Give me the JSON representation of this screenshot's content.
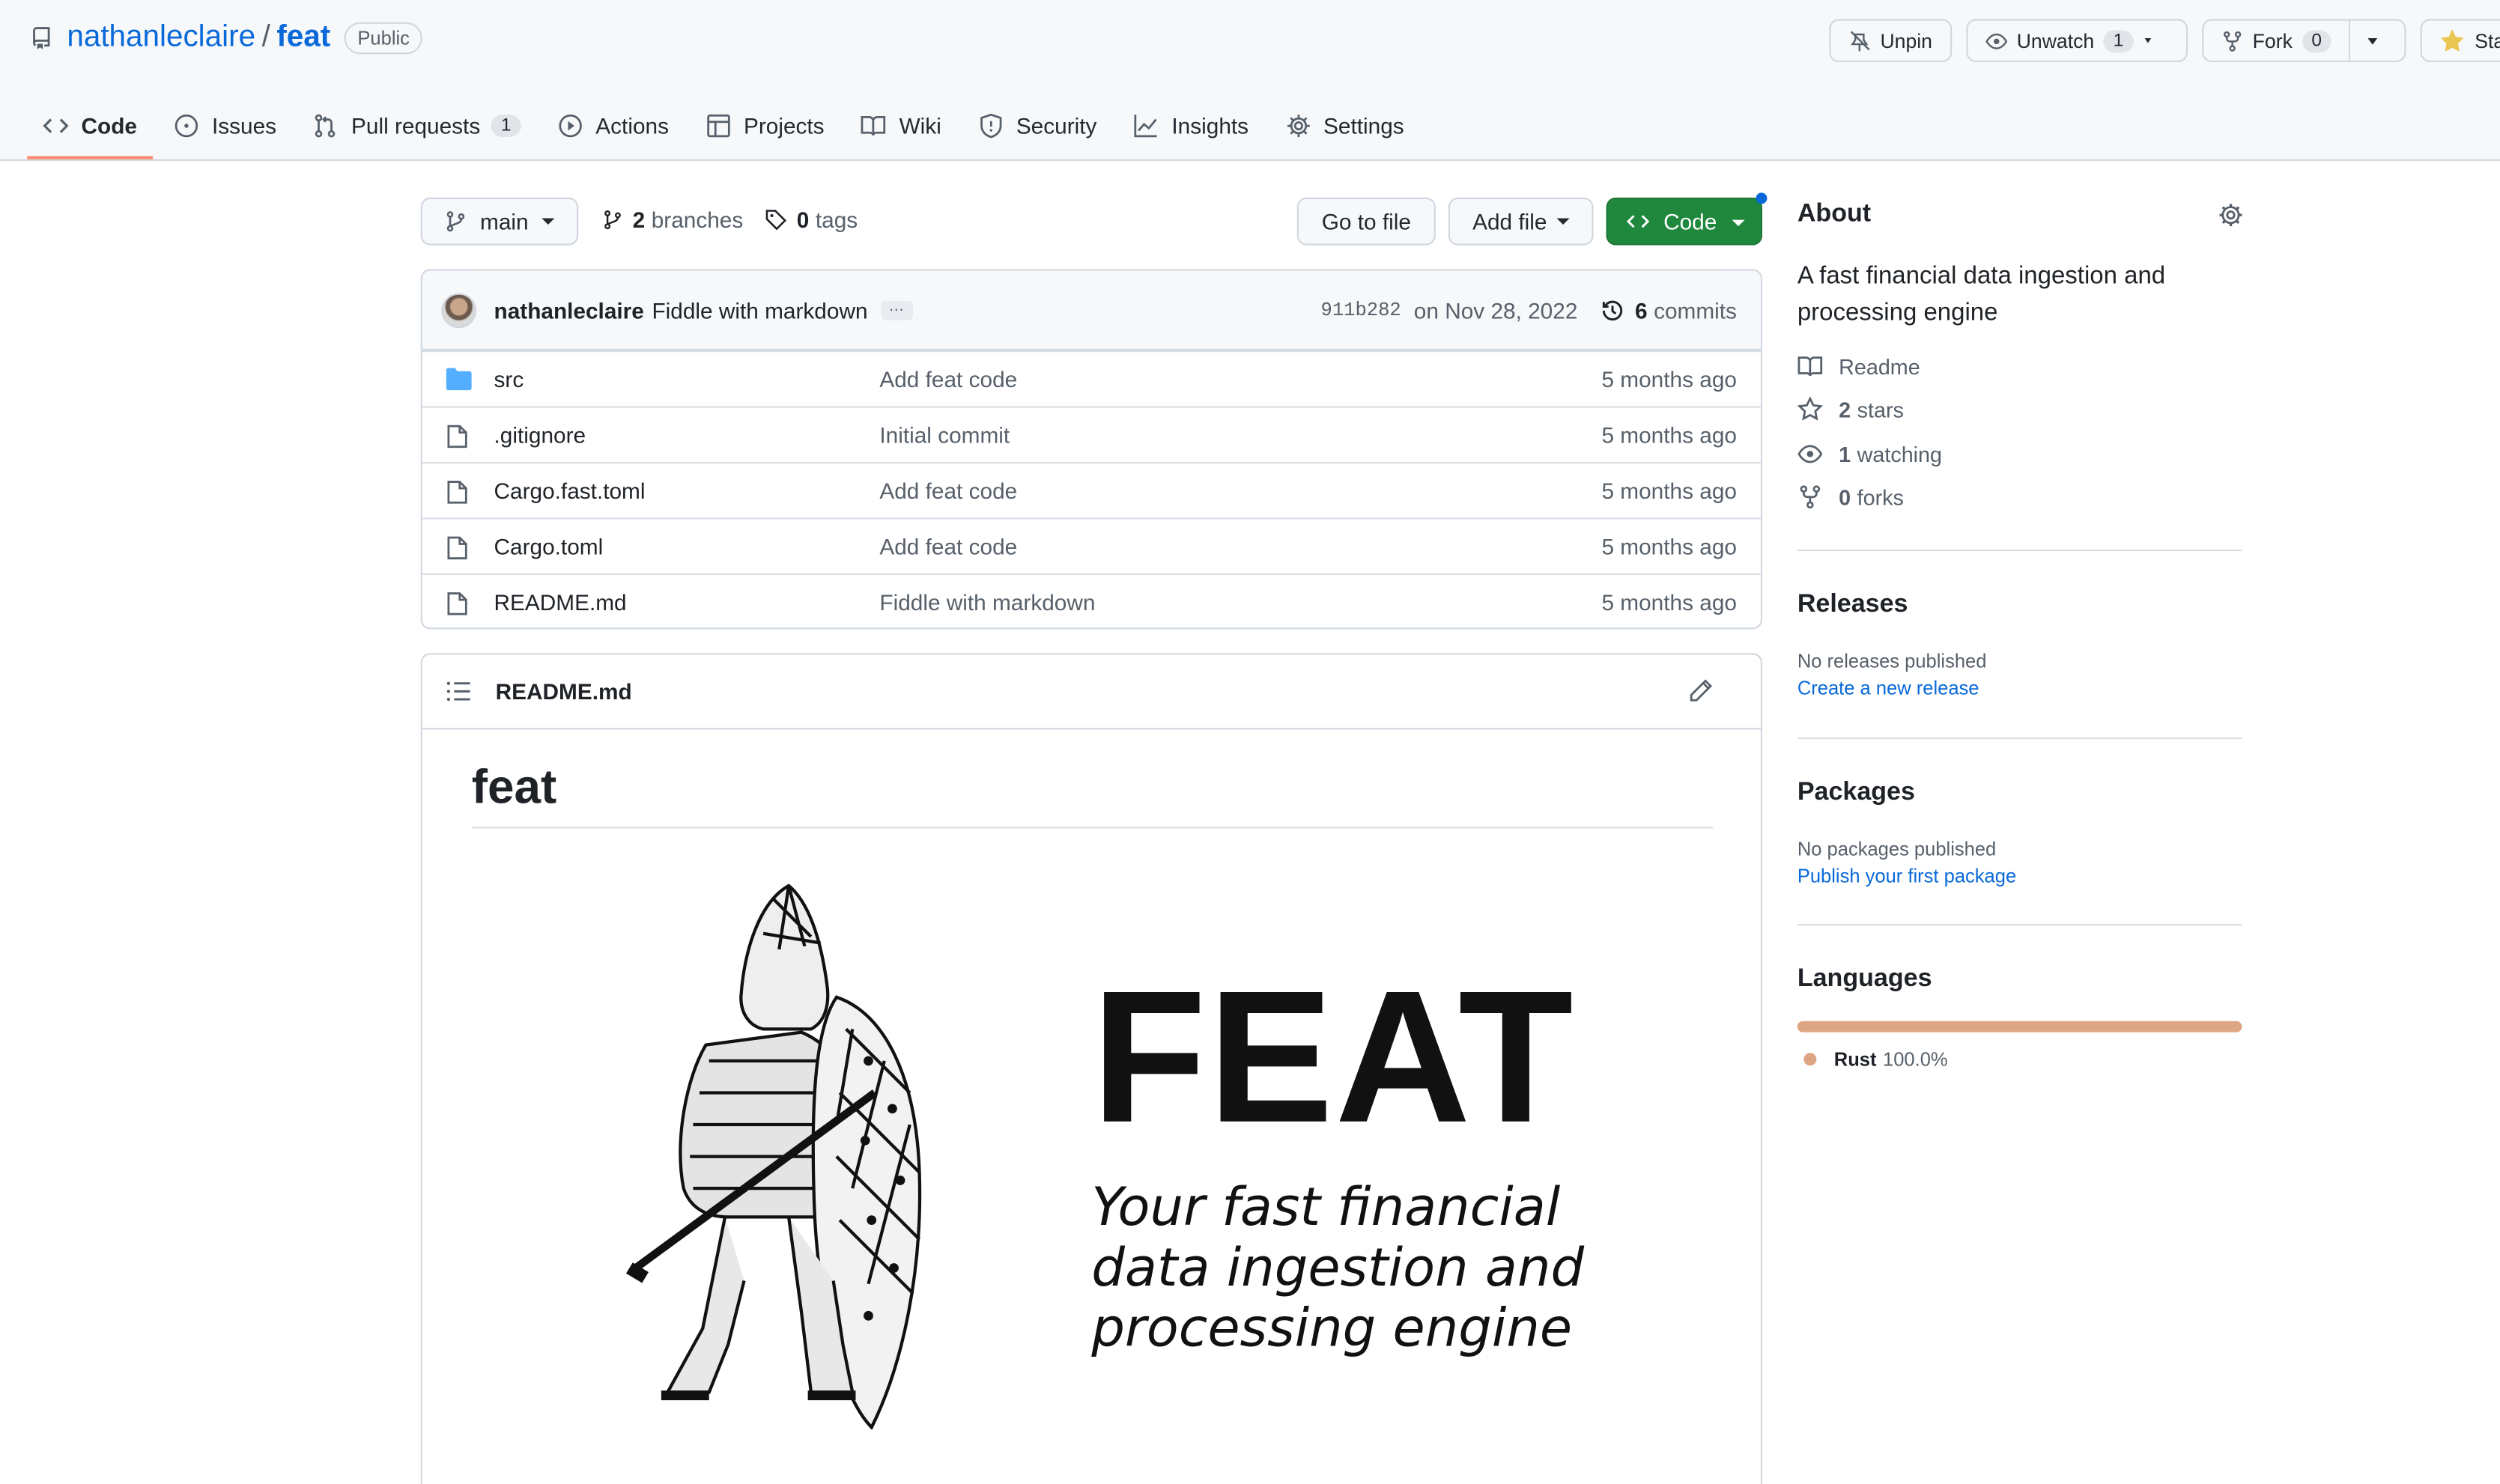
{
  "repo": {
    "owner": "nathanleclaire",
    "separator": "/",
    "name": "feat",
    "visibility": "Public"
  },
  "header_actions": {
    "unpin": "Unpin",
    "unwatch": "Unwatch",
    "watch_count": "1",
    "fork": "Fork",
    "fork_count": "0",
    "star": "Star"
  },
  "tabs": [
    {
      "label": "Code",
      "icon": "code-icon",
      "active": true
    },
    {
      "label": "Issues",
      "icon": "issue-icon"
    },
    {
      "label": "Pull requests",
      "icon": "pull-request-icon",
      "count": "1"
    },
    {
      "label": "Actions",
      "icon": "play-icon"
    },
    {
      "label": "Projects",
      "icon": "table-icon"
    },
    {
      "label": "Wiki",
      "icon": "book-icon"
    },
    {
      "label": "Security",
      "icon": "shield-icon"
    },
    {
      "label": "Insights",
      "icon": "graph-icon"
    },
    {
      "label": "Settings",
      "icon": "gear-icon"
    }
  ],
  "file_nav": {
    "branch": "main",
    "branches_count": "2",
    "branches_label": "branches",
    "tags_count": "0",
    "tags_label": "tags",
    "go_to_file": "Go to file",
    "add_file": "Add file",
    "code": "Code"
  },
  "latest_commit": {
    "author": "nathanleclaire",
    "message": "Fiddle with markdown",
    "ellipsis": "…",
    "sha": "911b282",
    "date": "on Nov 28, 2022",
    "commits_count": "6",
    "commits_label": "commits"
  },
  "files": [
    {
      "name": "src",
      "type": "folder",
      "commit": "Add feat code",
      "age": "5 months ago"
    },
    {
      "name": ".gitignore",
      "type": "file",
      "commit": "Initial commit",
      "age": "5 months ago"
    },
    {
      "name": "Cargo.fast.toml",
      "type": "file",
      "commit": "Add feat code",
      "age": "5 months ago"
    },
    {
      "name": "Cargo.toml",
      "type": "file",
      "commit": "Add feat code",
      "age": "5 months ago"
    },
    {
      "name": "README.md",
      "type": "file",
      "commit": "Fiddle with markdown",
      "age": "5 months ago"
    }
  ],
  "readme": {
    "filename": "README.md",
    "heading": "feat",
    "banner_title": "FEAT",
    "banner_tagline": "Your fast financial\ndata ingestion and\nprocessing engine"
  },
  "sidebar": {
    "about_title": "About",
    "description": "A fast financial data ingestion and processing engine",
    "readme": "Readme",
    "stars_count": "2",
    "stars_label": "stars",
    "watching_count": "1",
    "watching_label": "watching",
    "forks_count": "0",
    "forks_label": "forks",
    "releases_title": "Releases",
    "releases_empty": "No releases published",
    "releases_link": "Create a new release",
    "packages_title": "Packages",
    "packages_empty": "No packages published",
    "packages_link": "Publish your first package",
    "languages_title": "Languages",
    "languages": [
      {
        "name": "Rust",
        "percent": "100.0%",
        "color": "#dea584"
      }
    ]
  },
  "colors": {
    "link": "#0969da",
    "primary_button": "#1f883d",
    "active_tab": "#fd8c73",
    "folder": "#54aeff"
  }
}
